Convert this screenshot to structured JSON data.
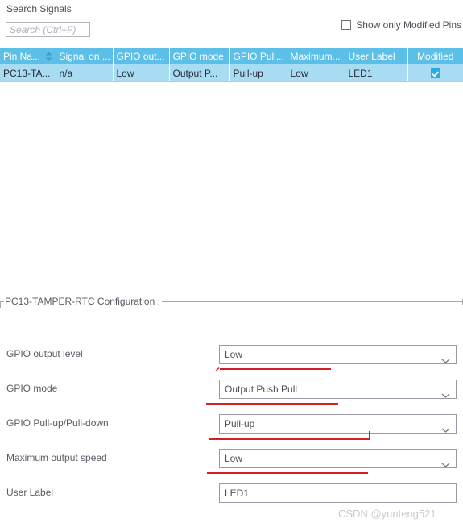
{
  "search": {
    "label": "Search Signals",
    "placeholder": "Search (Ctrl+F)",
    "value": ""
  },
  "filter": {
    "modified_pins_label": "Show only Modified Pins",
    "modified_pins_checked": false
  },
  "table": {
    "columns": [
      {
        "label": "Pin Na...",
        "sorted": true,
        "align": "left"
      },
      {
        "label": "Signal on ...",
        "sorted": false,
        "align": "left"
      },
      {
        "label": "GPIO out...",
        "sorted": false,
        "align": "left"
      },
      {
        "label": "GPIO mode",
        "sorted": false,
        "align": "left"
      },
      {
        "label": "GPIO Pull...",
        "sorted": false,
        "align": "left"
      },
      {
        "label": "Maximum...",
        "sorted": false,
        "align": "left"
      },
      {
        "label": "User Label",
        "sorted": false,
        "align": "left"
      },
      {
        "label": "Modified",
        "sorted": false,
        "align": "center"
      }
    ],
    "rows": [
      {
        "pin_name": "PC13-TA...",
        "signal_on": "n/a",
        "gpio_output": "Low",
        "gpio_mode": "Output P...",
        "gpio_pull": "Pull-up",
        "maximum": "Low",
        "user_label": "LED1",
        "modified": true
      }
    ]
  },
  "config": {
    "group_title": "PC13-TAMPER-RTC Configuration :",
    "fields": [
      {
        "label": "GPIO output level",
        "value": "Low",
        "type": "combo"
      },
      {
        "label": "GPIO mode",
        "value": "Output Push Pull",
        "type": "combo"
      },
      {
        "label": "GPIO Pull-up/Pull-down",
        "value": "Pull-up",
        "type": "combo"
      },
      {
        "label": "Maximum output speed",
        "value": "Low",
        "type": "combo"
      },
      {
        "label": "User Label",
        "value": "LED1",
        "type": "text"
      }
    ]
  },
  "watermark": {
    "text": "CSDN @yunteng521"
  },
  "colors": {
    "header_blue": "#5bbfe8",
    "row_blue": "#a8dcf2",
    "check_blue": "#2aaae0",
    "annotation_red": "#d41f26",
    "text_gray": "#5a5a64"
  }
}
